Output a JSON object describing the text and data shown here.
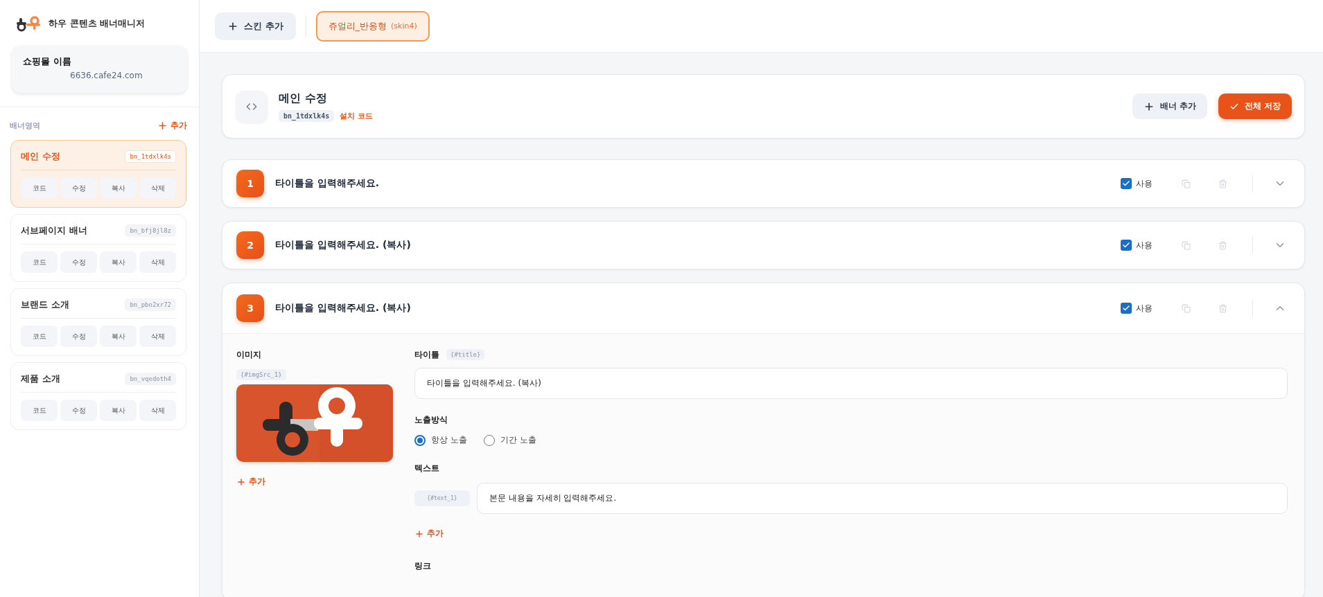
{
  "app": {
    "title": "하우 콘텐츠 배너매니저"
  },
  "shop": {
    "name": "쇼핑몰 이름",
    "domain": "6636.cafe24.com"
  },
  "banner_areas": {
    "heading": "배너영역",
    "add_label": "추가",
    "items": [
      {
        "name": "메인 수정",
        "code": "bn_1tdxlk4s",
        "selected": true,
        "actions": [
          "코드",
          "수정",
          "복사",
          "삭제"
        ]
      },
      {
        "name": "서브페이지 배너",
        "code": "bn_bfj8jl8z",
        "selected": false,
        "actions": [
          "코드",
          "수정",
          "복사",
          "삭제"
        ]
      },
      {
        "name": "브랜드 소개",
        "code": "bn_pbo2xr72",
        "selected": false,
        "actions": [
          "코드",
          "수정",
          "복사",
          "삭제"
        ]
      },
      {
        "name": "제품 소개",
        "code": "bn_vqedoth4",
        "selected": false,
        "actions": [
          "코드",
          "수정",
          "복사",
          "삭제"
        ]
      }
    ]
  },
  "toolbar": {
    "add_skin": "스킨 추가",
    "skins": [
      {
        "name": "쥬얼리_반응형",
        "id": "(skin4)",
        "selected": true
      }
    ]
  },
  "area_header": {
    "title": "메인 수정",
    "code": "bn_1tdxlk4s",
    "install_code": "설치 코드",
    "buttons": [
      {
        "label": "배너 추가",
        "kind": "secondary"
      },
      {
        "label": "전체 저장",
        "kind": "primary"
      }
    ]
  },
  "banners": [
    {
      "number": "1",
      "title": "타이틀을 입력해주세요.",
      "use_label": "사용",
      "enabled": true,
      "expanded": false
    },
    {
      "number": "2",
      "title": "타이틀을 입력해주세요. (복사)",
      "use_label": "사용",
      "enabled": true,
      "expanded": false
    },
    {
      "number": "3",
      "title": "타이틀을 입력해주세요. (복사)",
      "use_label": "사용",
      "enabled": true,
      "expanded": true,
      "detail": {
        "image": {
          "label": "이미지",
          "token": "{#imgSrc_1}",
          "add_label": "추가",
          "kind": "picture"
        },
        "title": {
          "label": "타이틀",
          "token": "{#title}",
          "value": "타이틀을 입력해주세요. (복사)"
        },
        "display": {
          "label": "노출방식",
          "options": [
            {
              "label": "항상 노출",
              "selected": true
            },
            {
              "label": "기간 노출",
              "selected": false
            }
          ]
        },
        "text": {
          "label": "텍스트",
          "items": [
            {
              "token": "{#text_1}",
              "value": "본문 내용을 자세히 입력해주세요."
            }
          ],
          "add_label": "추가"
        },
        "link": {
          "label": "링크"
        }
      }
    }
  ]
}
